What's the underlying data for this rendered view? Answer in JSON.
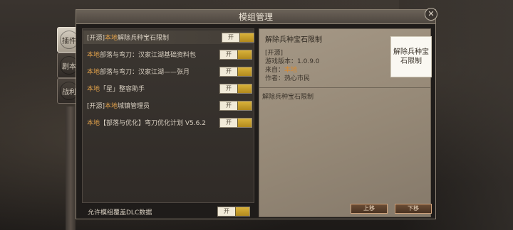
{
  "dialog": {
    "title": "模组管理",
    "close_symbol": "✕"
  },
  "side_tabs": [
    {
      "label": "插件",
      "active": true
    },
    {
      "label": "剧本",
      "active": false
    },
    {
      "label": "战利",
      "active": false
    }
  ],
  "mods": [
    {
      "prefix": "[开源]",
      "local": "本地",
      "name": "解除兵种宝石限制",
      "toggle": "开",
      "selected": true
    },
    {
      "prefix": "",
      "local": "本地",
      "name": "部落与弯刀：汉家江湖基础资料包",
      "toggle": "开",
      "selected": false
    },
    {
      "prefix": "",
      "local": "本地",
      "name": "部落与弯刀：汉家江湖——张月",
      "toggle": "开",
      "selected": false
    },
    {
      "prefix": "",
      "local": "本地",
      "name": "「星」整容助手",
      "toggle": "开",
      "selected": false
    },
    {
      "prefix": "[开源]",
      "local": "本地",
      "name": "城镇管理员",
      "toggle": "开",
      "selected": false
    },
    {
      "prefix": "",
      "local": "本地",
      "name": "【部落与优化】弯刀优化计划 V5.6.2",
      "toggle": "开",
      "selected": false
    }
  ],
  "bottom_option": {
    "label": "允许模组覆盖DLC数据",
    "toggle": "开"
  },
  "detail": {
    "title": "解除兵种宝石限制",
    "thumbnail_text": "解除兵种宝石限制",
    "open_source": "[开源]",
    "version_label": "游戏版本：",
    "version": "1.0.9.0",
    "source_label": "来自：",
    "source": "本地",
    "author_label": "作者：",
    "author": "热心市民",
    "description": "解除兵种宝石限制"
  },
  "buttons": {
    "move_up": "上移",
    "move_down": "下移"
  },
  "colors": {
    "local_tag": "#e0a04a",
    "toggle_knob": "#d9b23a",
    "detail_bg": "#a59886",
    "button_border": "#d1a27a"
  }
}
